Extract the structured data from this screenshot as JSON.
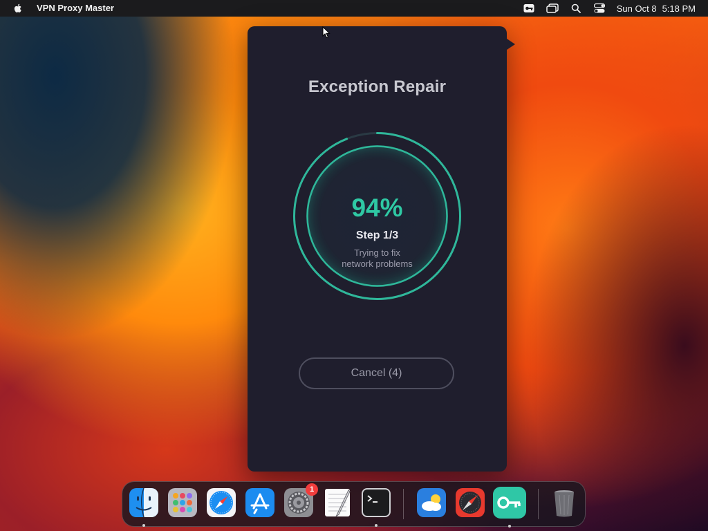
{
  "menubar": {
    "app_name": "VPN Proxy Master",
    "clock_date": "Sun Oct 8",
    "clock_time": "5:18 PM",
    "status_icons": [
      "vpn-status-icon",
      "window-switcher-icon",
      "search-icon",
      "control-center-icon"
    ]
  },
  "dialog": {
    "title": "Exception Repair",
    "progress_label": "94%",
    "progress_value": 0.94,
    "step": "Step 1/3",
    "description_line1": "Trying to fix",
    "description_line2": "network problems",
    "cancel_label": "Cancel (4)",
    "accent_color": "#2fc9a4",
    "background_color": "#1f1e2d"
  },
  "dock": {
    "items": [
      {
        "name": "finder",
        "running": true
      },
      {
        "name": "launchpad",
        "running": false
      },
      {
        "name": "safari",
        "running": false
      },
      {
        "name": "app-store",
        "running": false
      },
      {
        "name": "system-settings",
        "running": false,
        "badge": "1"
      },
      {
        "name": "textedit",
        "running": false
      },
      {
        "name": "terminal",
        "running": true
      },
      {
        "name": "weather",
        "running": false
      },
      {
        "name": "compass-app",
        "running": false
      },
      {
        "name": "vpn-proxy-master",
        "running": true
      },
      {
        "name": "trash",
        "running": false
      }
    ]
  }
}
